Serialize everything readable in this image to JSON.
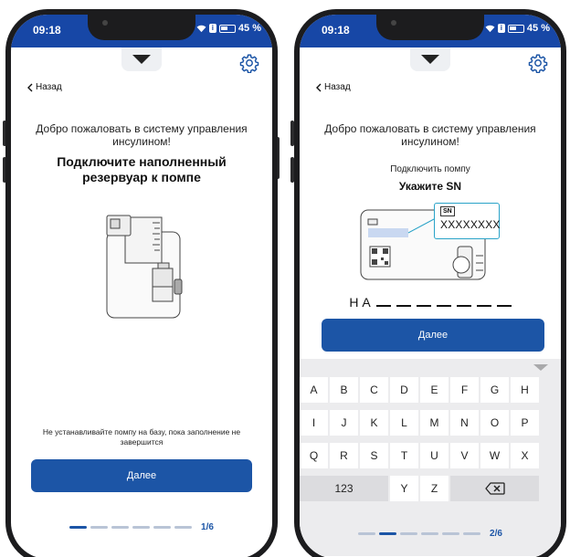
{
  "status": {
    "time": "09:18",
    "battery": "45 %"
  },
  "back_label": "Назад",
  "welcome_text": "Добро пожаловать в систему управления инсулином!",
  "screen1": {
    "headline": "Подключите наполненный резервуар к помпе",
    "note": "Не устанавливайте помпу на базу, пока заполнение не завершится",
    "next_label": "Далее",
    "step": "1/6",
    "active_segment": 1
  },
  "screen2": {
    "subtitle": "Подключить помпу",
    "headline": "Укажите SN",
    "sn_tag": "SN",
    "sn_placeholder": "XXXXXXXX",
    "sn_prefix": "Н А",
    "next_label": "Далее",
    "step": "2/6",
    "active_segment": 2
  },
  "keyboard": {
    "row1": [
      "A",
      "B",
      "C",
      "D",
      "E",
      "F",
      "G",
      "H"
    ],
    "row2": [
      "I",
      "J",
      "K",
      "L",
      "M",
      "N",
      "O",
      "P"
    ],
    "row3": [
      "Q",
      "R",
      "S",
      "T",
      "U",
      "V",
      "W",
      "X"
    ],
    "row4": [
      "123",
      "Y",
      "Z"
    ]
  },
  "colors": {
    "brand_blue": "#1c55a6",
    "status_blue": "#1747a6"
  }
}
